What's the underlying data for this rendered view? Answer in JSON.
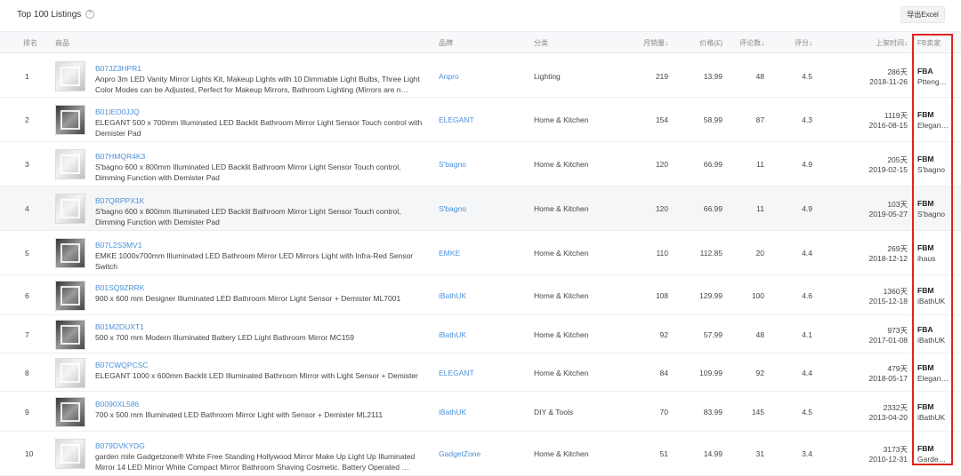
{
  "header": {
    "title": "Top 100 Listings",
    "help_icon": "?",
    "export_label": "导出Excel"
  },
  "columns": {
    "rank": "排名",
    "product": "商品",
    "brand": "品牌",
    "category": "分类",
    "monthly_sales": "月销量↓",
    "price": "价格(£)",
    "reviews": "评论数↓",
    "rating": "评分↓",
    "listed_time": "上架时间↓",
    "fba_seller": "FB卖家"
  },
  "rows": [
    {
      "rank": "1",
      "asin": "B07JZ3HPR1",
      "title": "Anpro 3m LED Vanity Mirror Lights Kit, Makeup Lights with 10 Dimmable Light Bulbs, Three Light Color Modes can be Adjusted, Perfect for Makeup Mirrors, Bathroom Lighting (Mirrors are n…",
      "brand": "Anpro",
      "category": "Lighting",
      "sales": "219",
      "price": "13.99",
      "reviews": "48",
      "rating": "4.5",
      "days": "286天",
      "date": "2018-11-26",
      "ship": "FBA",
      "seller": "Pttengc…"
    },
    {
      "rank": "2",
      "asin": "B01IEO0JJQ",
      "title": "ELEGANT 500 x 700mm Illuminated LED Backlit Bathroom Mirror Light Sensor Touch control with Demister Pad",
      "brand": "ELEGANT",
      "category": "Home & Kitchen",
      "sales": "154",
      "price": "58.99",
      "reviews": "87",
      "rating": "4.3",
      "days": "1119天",
      "date": "2016-08-15",
      "ship": "FBM",
      "seller": "Elegant…"
    },
    {
      "rank": "3",
      "asin": "B07HMQR4K3",
      "title": "S'bagno 600 x 800mm Illuminated LED Backlit Bathroom Mirror Light Sensor Touch control, Dimming Function with Demister Pad",
      "brand": "S'bagno",
      "category": "Home & Kitchen",
      "sales": "120",
      "price": "66.99",
      "reviews": "11",
      "rating": "4.9",
      "days": "205天",
      "date": "2019-02-15",
      "ship": "FBM",
      "seller": "S'bagno"
    },
    {
      "rank": "4",
      "asin": "B07QRPPX1K",
      "title": "S'bagno 600 x 800mm Illuminated LED Backlit Bathroom Mirror Light Sensor Touch control, Dimming Function with Demister Pad",
      "brand": "S'bagno",
      "category": "Home & Kitchen",
      "sales": "120",
      "price": "66.99",
      "reviews": "11",
      "rating": "4.9",
      "days": "103天",
      "date": "2019-05-27",
      "ship": "FBM",
      "seller": "S'bagno"
    },
    {
      "rank": "5",
      "asin": "B07L2S3MV1",
      "title": "EMKE 1000x700mm Illuminated LED Bathroom Mirror LED Mirrors Light with Infra-Red Sensor Switch",
      "brand": "EMKE",
      "category": "Home & Kitchen",
      "sales": "110",
      "price": "112.85",
      "reviews": "20",
      "rating": "4.4",
      "days": "269天",
      "date": "2018-12-12",
      "ship": "FBM",
      "seller": "ihaus"
    },
    {
      "rank": "6",
      "asin": "B01SQ9ZRRK",
      "title": "900 x 600 mm Designer Illuminated LED Bathroom Mirror Light Sensor + Demister ML7001",
      "brand": "iBathUK",
      "category": "Home & Kitchen",
      "sales": "108",
      "price": "129.99",
      "reviews": "100",
      "rating": "4.6",
      "days": "1360天",
      "date": "2015-12-18",
      "ship": "FBM",
      "seller": "iBathUK"
    },
    {
      "rank": "7",
      "asin": "B01M2DUXT1",
      "title": "500 x 700 mm Modern Illuminated Battery LED Light Bathroom Mirror MC159",
      "brand": "iBathUK",
      "category": "Home & Kitchen",
      "sales": "92",
      "price": "57.99",
      "reviews": "48",
      "rating": "4.1",
      "days": "973天",
      "date": "2017-01-08",
      "ship": "FBA",
      "seller": "iBathUK"
    },
    {
      "rank": "8",
      "asin": "B07CWQPCSC",
      "title": "ELEGANT 1000 x 600mm Backlit LED Illuminated Bathroom Mirror with Light Sensor + Demister",
      "brand": "ELEGANT",
      "category": "Home & Kitchen",
      "sales": "84",
      "price": "109.99",
      "reviews": "92",
      "rating": "4.4",
      "days": "479天",
      "date": "2018-05-17",
      "ship": "FBM",
      "seller": "Elegant…"
    },
    {
      "rank": "9",
      "asin": "B0090XL586",
      "title": "700 x 500 mm Illuminated LED Bathroom Mirror Light with Sensor + Demister ML2111",
      "brand": "iBathUK",
      "category": "DIY & Tools",
      "sales": "70",
      "price": "83.99",
      "reviews": "145",
      "rating": "4.5",
      "days": "2332天",
      "date": "2013-04-20",
      "ship": "FBM",
      "seller": "iBathUK"
    },
    {
      "rank": "10",
      "asin": "B079DVKYDG",
      "title": "garden mile Gadgetzone® White Free Standing Hollywood Mirror Make Up Light Up Illuminated Mirror 14 LED Mirror White Compact Mirror Bathroom Shaving Cosmetic. Battery Operated …",
      "brand": "GadgetZone",
      "category": "Home & Kitchen",
      "sales": "51",
      "price": "14.99",
      "reviews": "31",
      "rating": "3.4",
      "days": "3173天",
      "date": "2010-12-31",
      "ship": "FBM",
      "seller": "Garden_…"
    }
  ]
}
